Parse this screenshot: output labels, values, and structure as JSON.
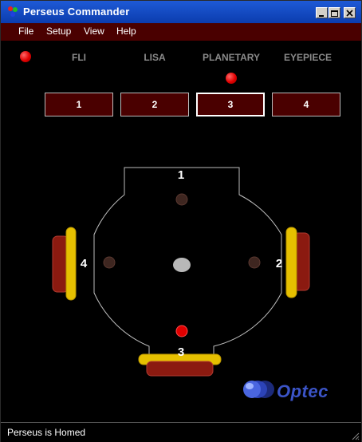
{
  "window": {
    "title": "Perseus Commander"
  },
  "menu": {
    "items": [
      "File",
      "Setup",
      "View",
      "Help"
    ]
  },
  "ports": {
    "labels": [
      "FLI",
      "LISA",
      "PLANETARY",
      "EYEPIECE"
    ]
  },
  "position_buttons": {
    "labels": [
      "1",
      "2",
      "3",
      "4"
    ],
    "selected": "3"
  },
  "diagram": {
    "numbers": [
      "1",
      "2",
      "3",
      "4"
    ]
  },
  "logo": {
    "text": "Optec"
  },
  "status": {
    "text": "Perseus is Homed"
  },
  "colors": {
    "menu_bg": "#4a0000",
    "indicator_red": "#e00000",
    "arm_yellow": "#e6c000",
    "pad_red": "#8b1a10",
    "logo_blue": "#3b54c7"
  }
}
